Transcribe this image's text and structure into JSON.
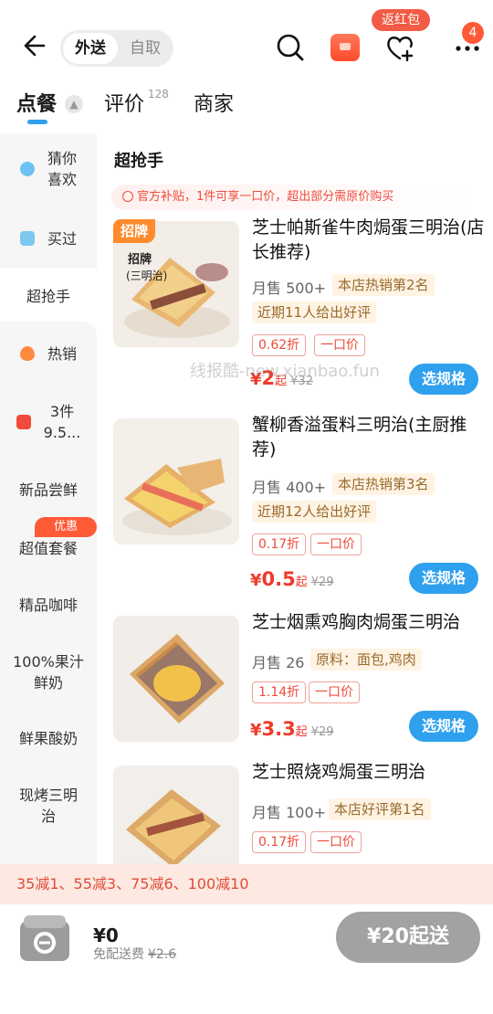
{
  "header": {
    "mode_active": "外送",
    "mode_inactive": "自取",
    "red_envelope_badge": "返红包",
    "more_badge_count": "4"
  },
  "tabs": [
    {
      "label": "点餐"
    },
    {
      "label": "评价",
      "count": "128"
    },
    {
      "label": "商家"
    }
  ],
  "sidebar": {
    "items": [
      {
        "label": "猜你\n喜欢",
        "icon": "blue-badge-icon"
      },
      {
        "label": "买过",
        "icon": "bag-icon"
      },
      {
        "label": "超抢手"
      },
      {
        "label": "热销",
        "icon": "flame-icon"
      },
      {
        "label": "3件\n9.5...",
        "icon": "discount-icon"
      },
      {
        "label": "新品尝鲜"
      },
      {
        "label": "超值套餐",
        "badge": "优惠"
      },
      {
        "label": "精品咖啡"
      },
      {
        "label": "100%果汁\n鲜奶"
      },
      {
        "label": "鲜果酸奶"
      },
      {
        "label": "现烤三明\n治"
      }
    ]
  },
  "section": {
    "title": "超抢手",
    "notice": "官方补贴，1件可享一口价，超出部分需原价购买"
  },
  "products": [
    {
      "title": "芝士帕斯雀牛肉焗蛋三明治(店长推荐)",
      "badge": "招牌",
      "sold": "月售 500+",
      "tag1": "本店热销第2名",
      "tag2": "近期11人给出好评",
      "discount": "0.62折",
      "one_price": "一口价",
      "price_symbol": "¥",
      "price": "2",
      "price_suffix": "起",
      "orig_price": "¥32",
      "button": "选规格"
    },
    {
      "title": "蟹柳香溢蛋料三明治(主厨推荐)",
      "sold": "月售 400+",
      "tag1": "本店热销第3名",
      "tag2": "近期12人给出好评",
      "discount": "0.17折",
      "one_price": "一口价",
      "price_symbol": "¥",
      "price": "0.5",
      "price_suffix": "起",
      "orig_price": "¥29",
      "button": "选规格"
    },
    {
      "title": "芝士烟熏鸡胸肉焗蛋三明治",
      "sold": "月售 26",
      "tag1": "原料：面包,鸡肉",
      "discount": "1.14折",
      "one_price": "一口价",
      "price_symbol": "¥",
      "price": "3.3",
      "price_suffix": "起",
      "orig_price": "¥29",
      "button": "选规格"
    },
    {
      "title": "芝士照烧鸡焗蛋三明治",
      "sold": "月售 100+",
      "tag1": "本店好评第1名",
      "discount": "0.17折",
      "one_price": "一口价"
    }
  ],
  "watermark": "线报酷-new.xianbao.fun",
  "promo_bar": "35减1、55减3、75减6、100减10",
  "cart": {
    "total": "¥0",
    "shipping_label": "免配送费",
    "shipping_orig": "¥2.6",
    "min_order": "¥20起送"
  }
}
